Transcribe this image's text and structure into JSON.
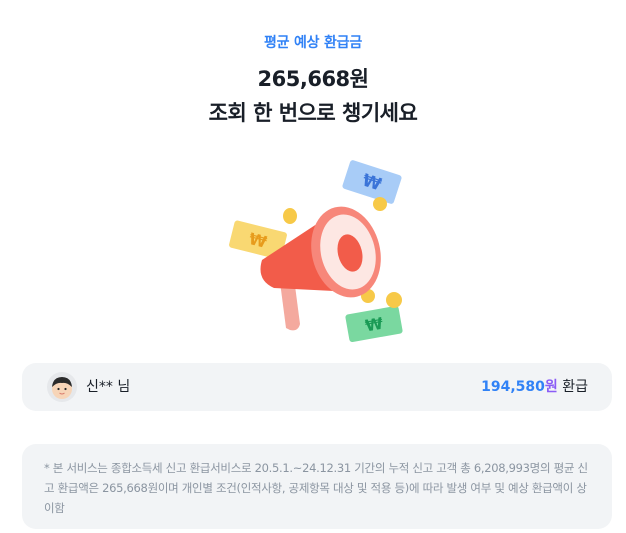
{
  "header": {
    "label": "평균 예상 환급금",
    "amount": "265,668원",
    "subtitle": "조회 한 번으로 챙기세요"
  },
  "user_card": {
    "name": "신** 님",
    "refund_amount": "194,580",
    "refund_unit": "원",
    "refund_suffix": "환급"
  },
  "notice": {
    "text": "* 본 서비스는 종합소득세 신고 환급서비스로 20.5.1.~24.12.31 기간의 누적 신고 고객 총 6,208,993명의 평균 신고 환급액은 265,668원이며 개인별 조건(인적사항, 공제항목 대상 및 적용 등)에 따라 발생 여부 및 예상 환급액이 상이함"
  },
  "illustration": {
    "icon": "megaphone-icon",
    "bills": [
      "₩",
      "₩",
      "₩"
    ]
  },
  "colors": {
    "accent": "#3182f6",
    "unit": "#8b5cf6",
    "card_bg": "#f2f4f6",
    "text": "#191f28",
    "muted": "#8b95a1"
  }
}
